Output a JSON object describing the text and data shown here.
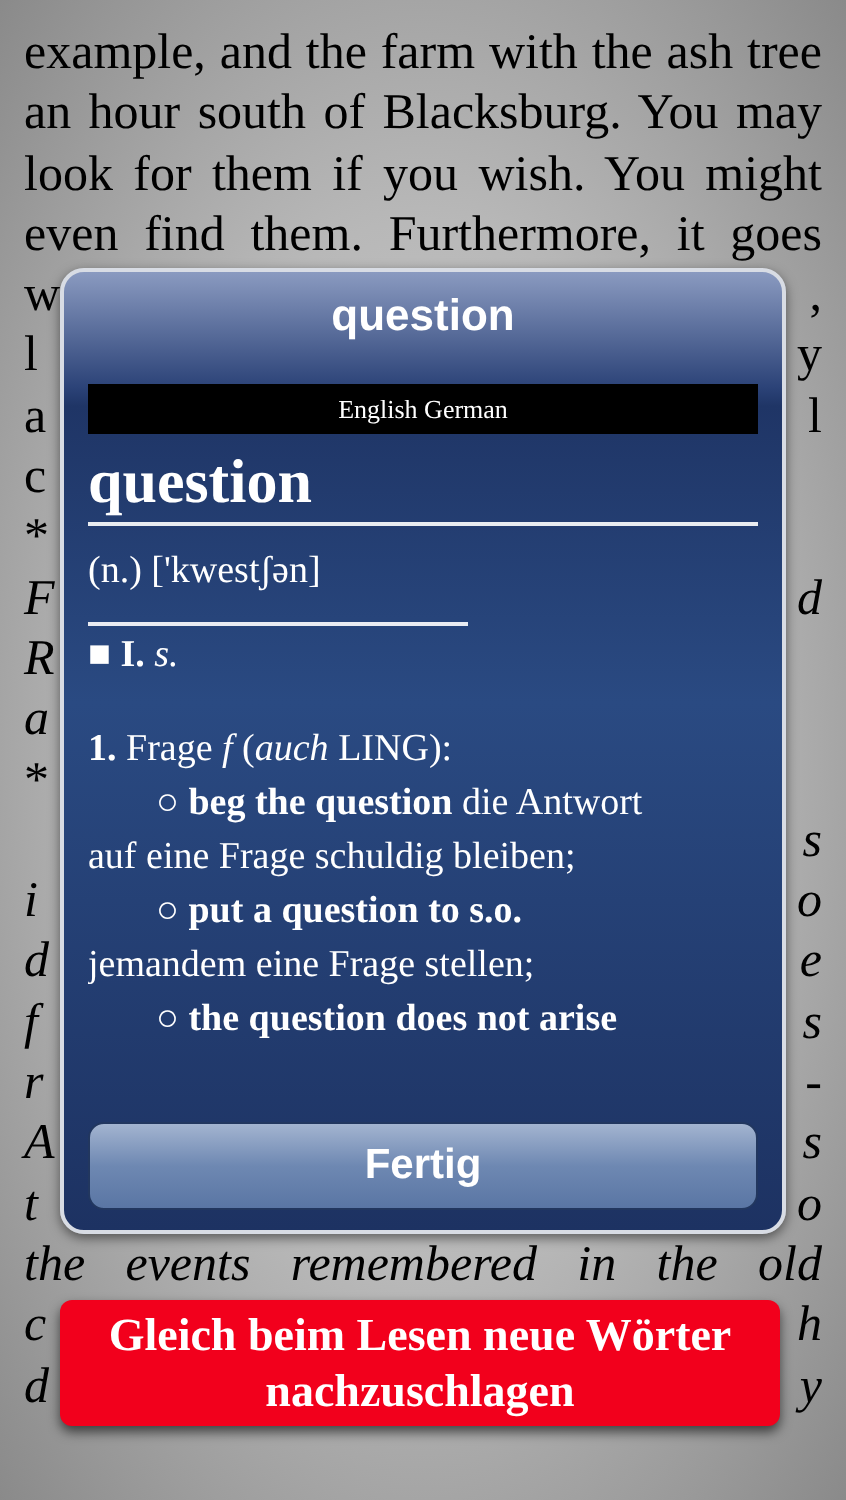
{
  "book": {
    "lines": [
      {
        "italic": false,
        "text": "example, and the farm with the ash tree"
      },
      {
        "italic": false,
        "text": "an hour south of Blacksburg. You may"
      },
      {
        "italic": false,
        "text": "look for them if you wish. You might"
      },
      {
        "italic": false,
        "text": "even find them. Furthermore, it goes"
      },
      {
        "italic": false,
        "left": "w",
        "right": ","
      },
      {
        "italic": false,
        "left": "l",
        "right": "y"
      },
      {
        "italic": false,
        "left": "a",
        "right": "l"
      },
      {
        "italic": false,
        "left": "c"
      },
      {
        "italic": false,
        "left": "*"
      },
      {
        "italic": true,
        "left": "F",
        "right": "d"
      },
      {
        "italic": true,
        "left": "R"
      },
      {
        "italic": true,
        "left": "a"
      },
      {
        "italic": false,
        "left": "*"
      },
      {
        "italic": true,
        "right": "s"
      },
      {
        "italic": true,
        "left": "i",
        "right": "o"
      },
      {
        "italic": true,
        "left": "d",
        "right": "e"
      },
      {
        "italic": true,
        "left": "f",
        "right": "s"
      },
      {
        "italic": true,
        "left": "r",
        "right": "-"
      },
      {
        "italic": true,
        "left": "A",
        "right": "s"
      },
      {
        "italic": true,
        "left": "t",
        "right": "o"
      },
      {
        "italic": true,
        "text": "the events remembered in the old"
      },
      {
        "italic": true,
        "left": "c",
        "right": "h"
      },
      {
        "italic": true,
        "left": "d",
        "right": "y"
      }
    ]
  },
  "dialog": {
    "title": "question",
    "dictionary": "English German",
    "entries": [
      {
        "kind": "headword",
        "text": "question"
      },
      {
        "kind": "pron",
        "text": "(n.) ['kwestʃən]"
      },
      {
        "kind": "sense",
        "text": "■ **I.** *s.*"
      },
      {
        "kind": "gap"
      },
      {
        "kind": "line",
        "text": "**1.** Frage *f* (*auch* LING):"
      },
      {
        "kind": "example",
        "text": "○ **beg the question** die Antwort"
      },
      {
        "kind": "line",
        "text": "auf eine Frage schuldig bleiben;"
      },
      {
        "kind": "example",
        "text": "○ **put a question to s.o.**"
      },
      {
        "kind": "line",
        "text": "jemandem eine Frage stellen;"
      },
      {
        "kind": "example",
        "text": "○ **the question does not arise**"
      }
    ],
    "button": "Fertig"
  },
  "banner": {
    "text": "Gleich beim Lesen neue Wörter nachzuschlagen"
  }
}
